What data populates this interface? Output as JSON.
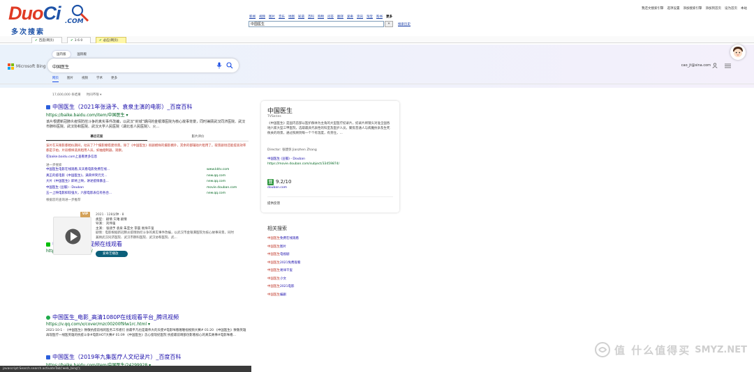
{
  "duoci": {
    "logo_duo": "Duo",
    "logo_ci": "Ci",
    "logo_com": ".COM",
    "logo_sub": "多次搜索",
    "nav": [
      "新闻",
      "视频",
      "图片",
      "音乐",
      "地图",
      "知道",
      "百科",
      "购物",
      "问答",
      "翻译",
      "爱奇",
      "资讯",
      "淘宝",
      "购书",
      "游戏",
      "明星",
      "书签",
      "更多"
    ],
    "search_value": "中国医生",
    "go_label": "»",
    "help_link": "搜索历史",
    "top_links": [
      "我还文搜索引擎",
      "选项设置",
      "添加搜索引擎",
      "添加到首页",
      "设为首页",
      "本站"
    ],
    "tabs": [
      {
        "label": "百度(网页)",
        "active": false
      },
      {
        "label": "3 6 0",
        "active": false
      },
      {
        "label": "必应(网页)",
        "active": true
      }
    ]
  },
  "bing": {
    "brand": "Microsoft Bing",
    "region_tabs": [
      "国内版",
      "国际版"
    ],
    "query": "中国医生",
    "account": "cao_jt@sina.com",
    "scopes": [
      "网页",
      "图片",
      "视频",
      "学术",
      "更多"
    ],
    "result_count": "17,600,000 条结果",
    "time_filter": "时间不限 ▾",
    "results": {
      "r1": {
        "title": "中国医生（2021年张涵予、袁泉主演的电影）_百度百科",
        "url": "https://baike.baidu.com/item/中国医生 ▾",
        "snippet": "该片根据新冠肺炎疫情防控斗争的真实事件改编，以武汉“封城”期间的金银潭医院为核心故事背景，同时兼顾武汉同济医院、武汉市肺科医院、武汉协和医院、武汉大学人民医院（湖北省人民医院）、火...",
        "subtabs": [
          "幕后花絮",
          "影片评价"
        ],
        "subtext": "该片在天眼影都相似期间，动员了7个摄影棚搭建场景。除了《中国医生》很剧模样的摄影棚外，其余的都辅助片租用了。取景剧场还能提高效率都是于拍，片段模样道具租用人员，如抽烟制器，观察。",
        "more": "在baike.baidu.com上查看更多信息",
        "further_label": "进一步搜索",
        "further": [
          {
            "l": "中国医生电影在线观看,天天看电影免费在线...",
            "r": "www.kktv.com"
          },
          {
            "l": "真正的疫电影《中国医生》，满荣抨突元元...",
            "r": "new.qq.com"
          },
          {
            "l": "大片《中国医生》即将上映，讲述疫情暴击...",
            "r": "new.qq.com"
          },
          {
            "l": "中国医生 (豆瓣) - Douban",
            "r": "movie.douban.com"
          },
          {
            "l": "五一上映电影抑较强大，六部电影表信有各合...",
            "r": "new.qq.com"
          }
        ],
        "feedback": "根据您的查询进一步推荐"
      },
      "r2": {
        "title": "中国医生_高清视频在线观看",
        "url": "https://www.iqiyi.com/",
        "vip": "VIP",
        "year_line": "2021 · 128分钟 · 8",
        "genre": "类型：  剧情      灾难      剧情",
        "director": "导演：  刘伟强",
        "cast": "主演：  张涵予    袁泉    朱亚文    李晨    易烊千玺",
        "plot": "剧情：电影根据新冠肺炎疫情防控斗争的真实事件改编，以武汉市金银潭医院为核心故事背景，同时兼顾武汉同济医院、武汉市肺科医院、武汉协和医院、武...",
        "play": "爱奇艺播放"
      },
      "r3": {
        "title": "中国医生_电影_高清1080P在线观看平台_腾讯视频",
        "url": "https://v.qq.com/x/cover/mzc00200f9lw1rc.html ▾",
        "snippet": "2021-10-1 · 《中国医生》致敬抗疫前线的医务工作者们 县最平凡也是最伟大的天使#电影咪看喔喔视视频大赛# 01:20 《中国医生》致敬英雄 再现医疗一线医英雄的抗疫斗争#电影HOT大赛# 01:09 《中国医生》念心窗现纪医院 抗疫最前哨部创影看核心的真实故事#电影咪看..."
      },
      "r4": {
        "title": "中国医生（2019年九集医疗人文纪录片）_百度百科",
        "url": "https://baike.baidu.com/item/中国医生/24299928 ▾"
      }
    },
    "knowledge": {
      "title": "中国医生",
      "subtitle": "TVSeries",
      "desc": "《中国医生》是国内首部以医护群体为主角的大型医疗纪录片，纪录片将镜头对准全国各地六家大型三甲医院，选取最具代表性的科室及医护人员，聚焦普通人与病魔抗争及生死攸关的场景，通过照顾到每一个个有温度，有责任，...",
      "director": "Director:  张建弥 Jianzhen Zhang",
      "source": "中国医生 (豆瓣) - Douban",
      "source_url": "https://movie.douban.com/subject/33459874/",
      "db_icon": "豆",
      "score": "9.2/10",
      "db_site": "douban.com",
      "feedback": "提供反馈"
    },
    "related": {
      "heading": "相关搜索",
      "items": [
        {
          "r": "中国医生",
          "b": "免费在线观看"
        },
        {
          "r": "中国医生",
          "b": "图片"
        },
        {
          "r": "中国医生",
          "b": "电视剧"
        },
        {
          "r": "中国医生",
          "b": "2021免费观看"
        },
        {
          "r": "中国医生",
          "b": "易烊千玺"
        },
        {
          "r": "中国医生",
          "b": "小文"
        },
        {
          "r": "中国医生",
          "b": "2021电影"
        },
        {
          "r": "中国医生",
          "b": "编剧"
        }
      ]
    }
  },
  "statusbar": "javascript:Search.search.activateTab('web_bing');",
  "watermark": {
    "zh": "值 什么值得买",
    "en": "SMYZ.NET"
  },
  "colors": {
    "duo_red": "#e03a24",
    "duo_blue": "#1e53a8",
    "bing_blue": "#174ae4",
    "link": "#1a0dab",
    "url_green": "#006621"
  }
}
